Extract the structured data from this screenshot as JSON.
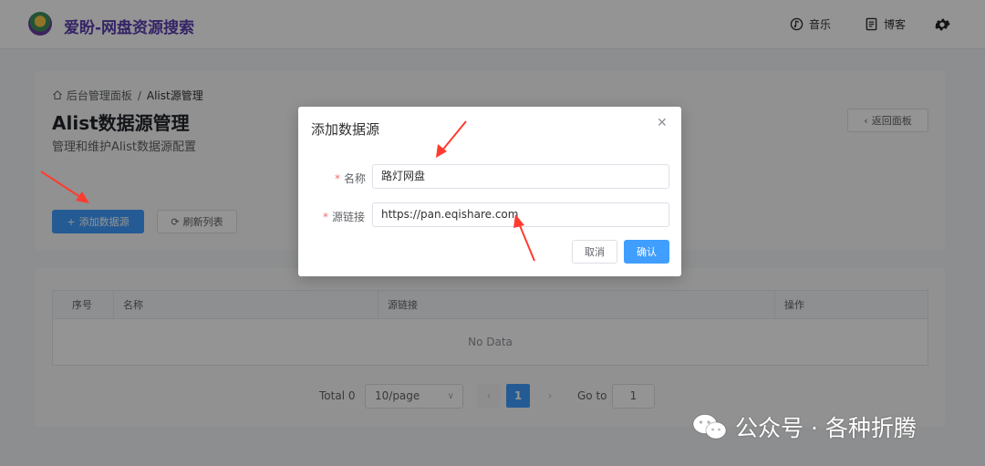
{
  "header": {
    "app_title": "爱盼-网盘资源搜索",
    "music_label": "音乐",
    "blog_label": "博客",
    "icons": [
      "logo-icon",
      "music-icon",
      "blog-icon",
      "gear-icon"
    ]
  },
  "breadcrumb": {
    "home": "后台管理面板",
    "separator": "/",
    "current": "Alist源管理"
  },
  "page": {
    "title": "Alist数据源管理",
    "subtitle": "管理和维护Alist数据源配置",
    "back_button": "返回面板",
    "add_button": "添加数据源",
    "refresh_button": "刷新列表"
  },
  "table": {
    "columns": [
      "序号",
      "名称",
      "源链接",
      "操作"
    ],
    "rows": [],
    "empty_text": "No Data"
  },
  "pagination": {
    "total_label": "Total 0",
    "page_size": "10/page",
    "current_page": "1",
    "goto_label": "Go to",
    "goto_value": "1"
  },
  "dialog": {
    "title": "添加数据源",
    "name_label": "名称",
    "name_value": "路灯网盘",
    "url_label": "源链接",
    "url_value": "https://pan.eqishare.com",
    "cancel_label": "取消",
    "confirm_label": "确认"
  },
  "watermark": {
    "text": "公众号 · 各种折腾"
  },
  "colors": {
    "primary": "#409eff",
    "brand": "#5b3fb0",
    "annotation": "#ff3b30",
    "required": "#f56c6c"
  }
}
